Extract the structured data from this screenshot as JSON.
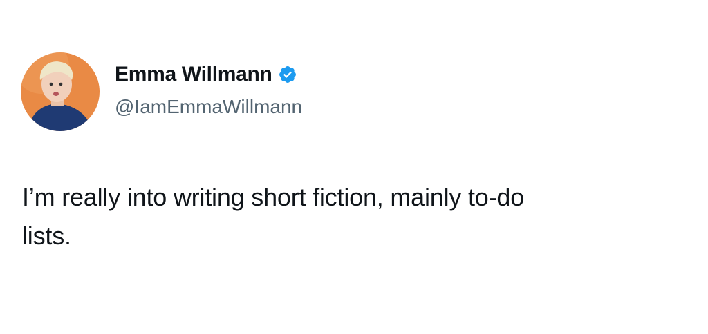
{
  "tweet": {
    "author": {
      "display_name": "Emma Willmann",
      "handle": "@IamEmmaWillmann",
      "verified": true,
      "avatar_icon": "profile-photo",
      "avatar_background": "#e98a45"
    },
    "text_lines": [
      "I’m really into writing short fiction, mainly to-do",
      "lists."
    ]
  },
  "colors": {
    "verified_badge": "#1d9bf0",
    "primary_text": "#0f1419",
    "secondary_text": "#536471"
  }
}
